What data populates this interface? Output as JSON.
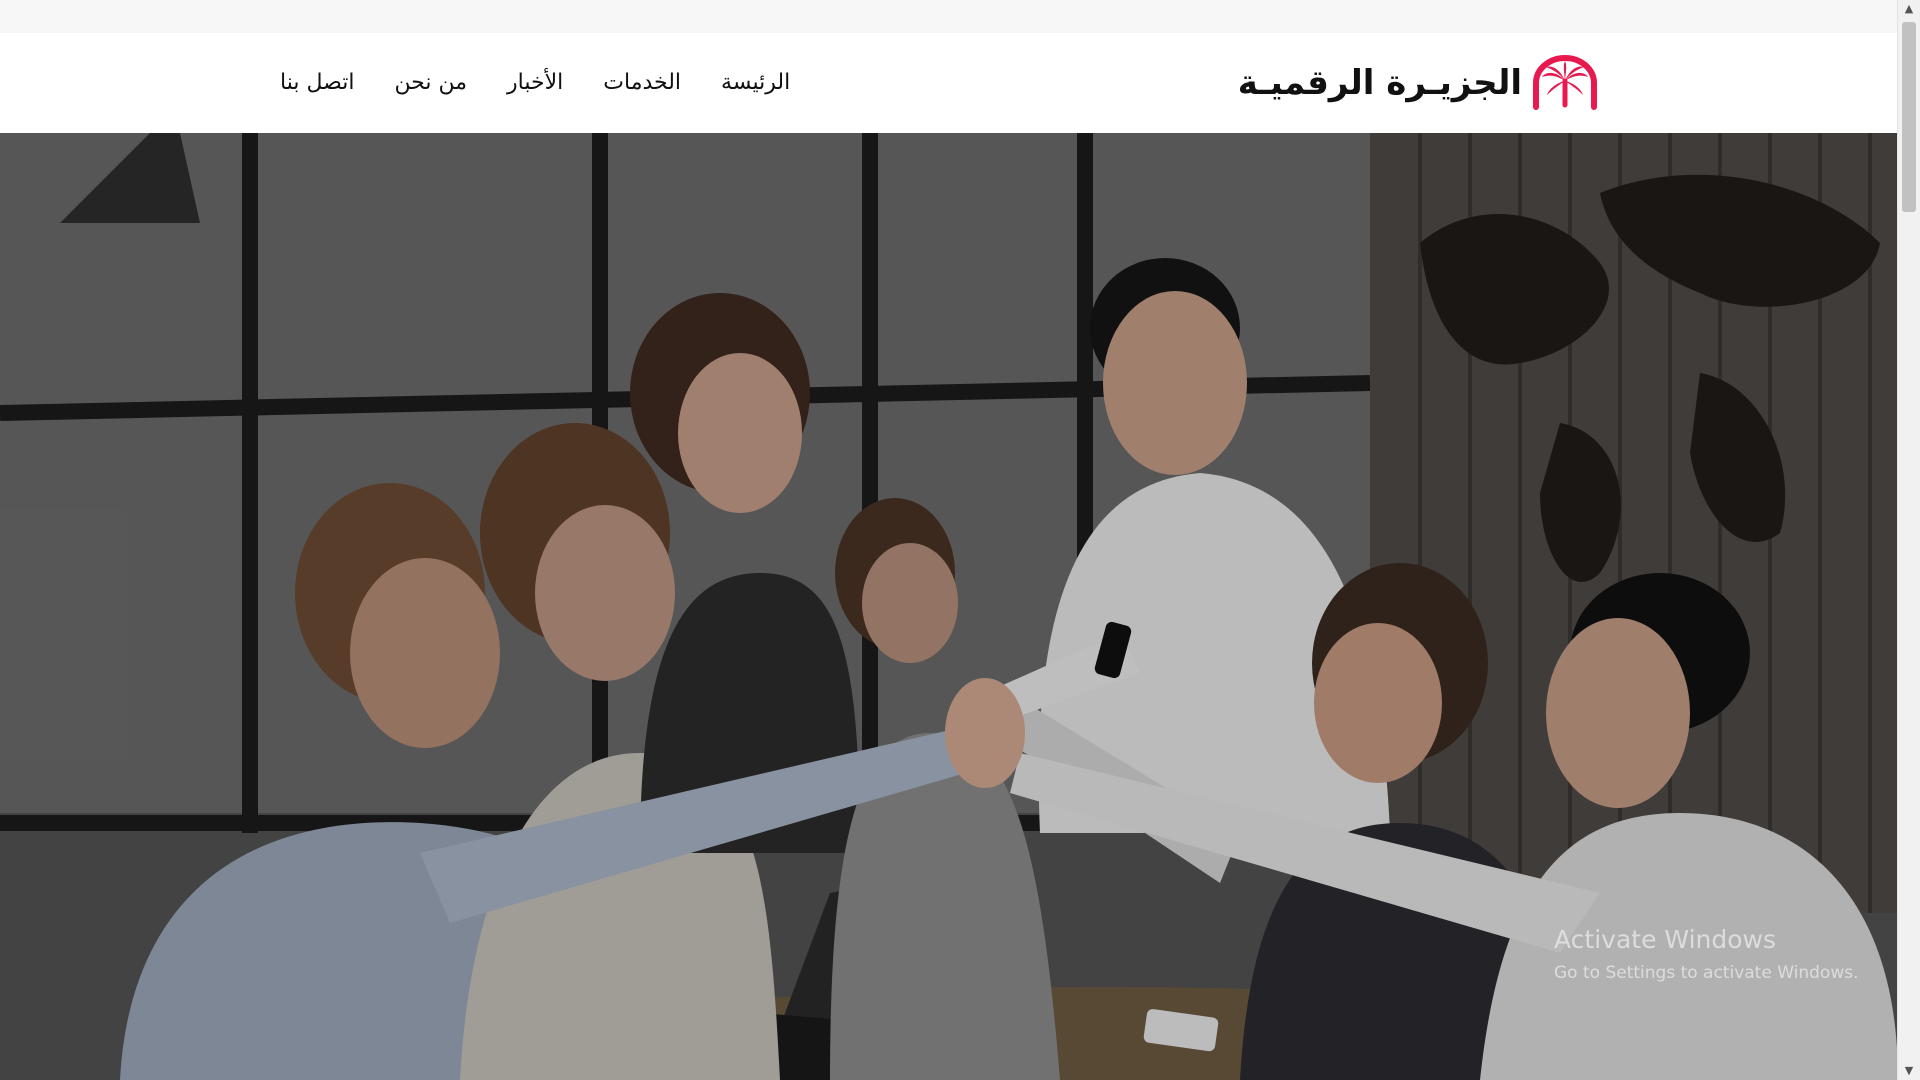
{
  "header": {
    "logo_text": "الجزيـرة الرقميـة",
    "nav": [
      {
        "label": "الرئيسة"
      },
      {
        "label": "الخدمات"
      },
      {
        "label": "الأخبار"
      },
      {
        "label": "من نحن"
      },
      {
        "label": "اتصل بنا"
      }
    ]
  },
  "hero": {
    "image": "team-high-five-office-photo"
  },
  "watermark": {
    "title": "Activate Windows",
    "subtitle": "Go to Settings to activate Windows."
  },
  "colors": {
    "brand": "#e8194f",
    "nav_text": "#111111"
  }
}
